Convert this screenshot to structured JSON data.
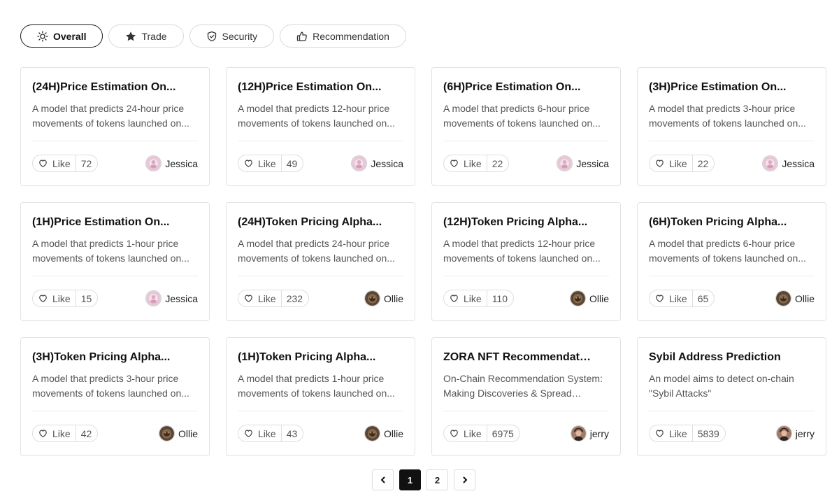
{
  "tabs": [
    {
      "label": "Overall",
      "icon": "sun-icon",
      "active": true
    },
    {
      "label": "Trade",
      "icon": "star-icon",
      "active": false
    },
    {
      "label": "Security",
      "icon": "shield-icon",
      "active": false
    },
    {
      "label": "Recommendation",
      "icon": "thumbs-up-icon",
      "active": false
    }
  ],
  "like_label": "Like",
  "cards": [
    {
      "title": "(24H)Price Estimation On...",
      "description": "A model that predicts 24-hour price movements of tokens launched on...",
      "likes": "72",
      "author": "Jessica",
      "avatar": "avatar-pink"
    },
    {
      "title": "(12H)Price Estimation On...",
      "description": "A model that predicts 12-hour price movements of tokens launched on...",
      "likes": "49",
      "author": "Jessica",
      "avatar": "avatar-pink"
    },
    {
      "title": "(6H)Price Estimation On...",
      "description": "A model that predicts 6-hour price movements of tokens launched on...",
      "likes": "22",
      "author": "Jessica",
      "avatar": "avatar-pink"
    },
    {
      "title": "(3H)Price Estimation On...",
      "description": "A model that predicts 3-hour price movements of tokens launched on...",
      "likes": "22",
      "author": "Jessica",
      "avatar": "avatar-pink"
    },
    {
      "title": "(1H)Price Estimation On...",
      "description": "A model that predicts 1-hour price movements of tokens launched on...",
      "likes": "15",
      "author": "Jessica",
      "avatar": "avatar-pink"
    },
    {
      "title": "(24H)Token Pricing Alpha...",
      "description": "A model that predicts 24-hour price movements of tokens launched on...",
      "likes": "232",
      "author": "Ollie",
      "avatar": "avatar-brown"
    },
    {
      "title": "(12H)Token Pricing Alpha...",
      "description": "A model that predicts 12-hour price movements of tokens launched on...",
      "likes": "110",
      "author": "Ollie",
      "avatar": "avatar-brown"
    },
    {
      "title": "(6H)Token Pricing Alpha...",
      "description": "A model that predicts 6-hour price movements of tokens launched on...",
      "likes": "65",
      "author": "Ollie",
      "avatar": "avatar-brown"
    },
    {
      "title": "(3H)Token Pricing Alpha...",
      "description": "A model that predicts 3-hour price movements of tokens launched on...",
      "likes": "42",
      "author": "Ollie",
      "avatar": "avatar-brown"
    },
    {
      "title": "(1H)Token Pricing Alpha...",
      "description": "A model that predicts 1-hour price movements of tokens launched on...",
      "likes": "43",
      "author": "Ollie",
      "avatar": "avatar-brown"
    },
    {
      "title": "ZORA NFT Recommendation...",
      "description": "On-Chain Recommendation System: Making Discoveries & Spread Easie...",
      "likes": "6975",
      "author": "jerry",
      "avatar": "avatar-photo"
    },
    {
      "title": "Sybil Address Prediction",
      "description": "An model aims to detect on-chain \"Sybil Attacks\"",
      "likes": "5839",
      "author": "jerry",
      "avatar": "avatar-photo"
    }
  ],
  "pagination": {
    "prev_icon": "chevron-left-icon",
    "next_icon": "chevron-right-icon",
    "pages": [
      "1",
      "2"
    ],
    "current": "1"
  }
}
